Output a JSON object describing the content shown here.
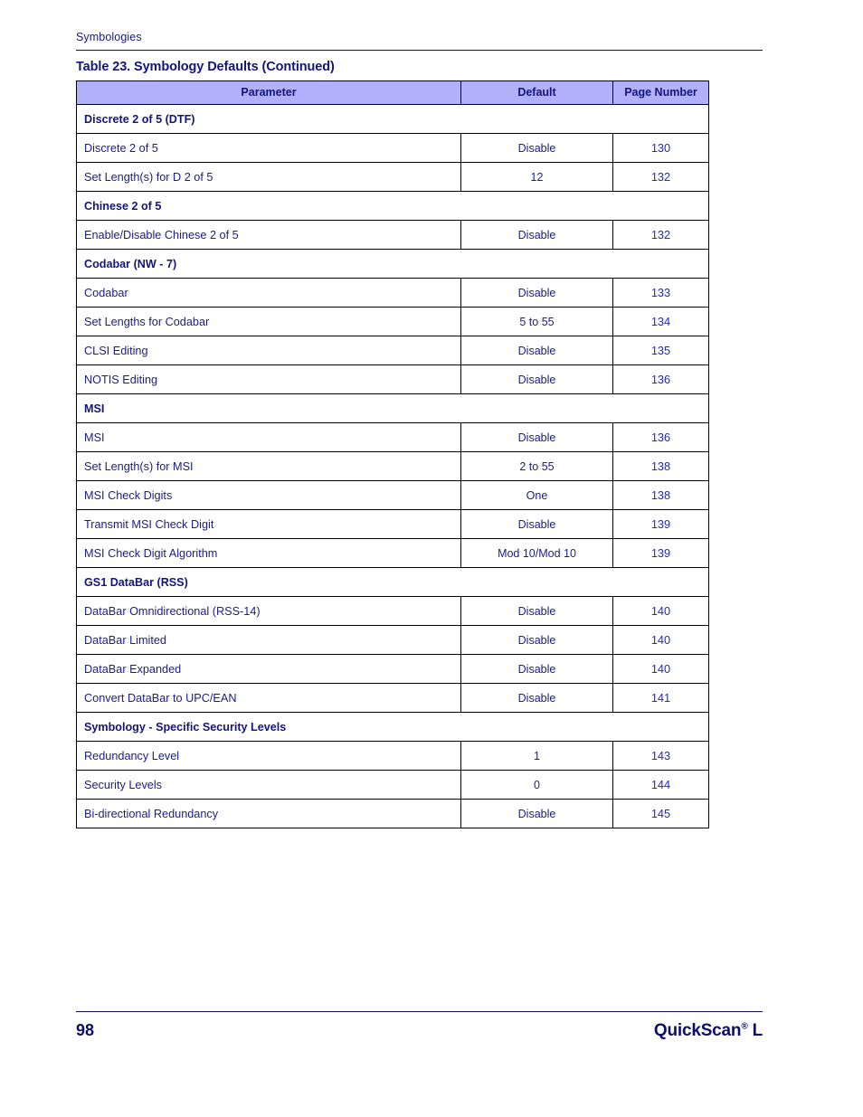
{
  "page": {
    "running_head": "Symbologies",
    "table_caption": "Table 23. Symbology Defaults (Continued)",
    "folio": "98",
    "book_title": "QuickScan",
    "book_title_sup": "®",
    "book_title_suffix": " L"
  },
  "colors": {
    "header_fill": "#b0b0fb",
    "heading_text": "#14147d",
    "body_text": "#1b1b8f",
    "page_link": "#2323e0",
    "rule": "#0d0d6b",
    "border": "#000000"
  },
  "table": {
    "columns": [
      "Parameter",
      "Default",
      "Page Number"
    ],
    "rows": [
      {
        "type": "section",
        "parameter": "Discrete 2 of 5 (DTF)"
      },
      {
        "type": "data",
        "parameter": "Discrete 2 of 5",
        "default": "Disable",
        "page": "130"
      },
      {
        "type": "data",
        "parameter": "Set Length(s) for D 2 of 5",
        "default": "12",
        "page": "132"
      },
      {
        "type": "section",
        "parameter": "Chinese 2 of 5"
      },
      {
        "type": "data",
        "parameter": "Enable/Disable Chinese 2 of 5",
        "default": "Disable",
        "page": "132"
      },
      {
        "type": "section",
        "parameter": "Codabar (NW - 7)"
      },
      {
        "type": "data",
        "parameter": "Codabar",
        "default": "Disable",
        "page": "133"
      },
      {
        "type": "data",
        "parameter": "Set Lengths for Codabar",
        "default": "5 to 55",
        "page": "134"
      },
      {
        "type": "data",
        "parameter": "CLSI Editing",
        "default": "Disable",
        "page": "135"
      },
      {
        "type": "data",
        "parameter": "NOTIS Editing",
        "default": "Disable",
        "page": "136"
      },
      {
        "type": "section",
        "parameter": "MSI"
      },
      {
        "type": "data",
        "parameter": "MSI",
        "default": "Disable",
        "page": "136"
      },
      {
        "type": "data",
        "parameter": "Set Length(s) for MSI",
        "default": "2 to 55",
        "page": "138"
      },
      {
        "type": "data",
        "parameter": "MSI Check Digits",
        "default": "One",
        "page": "138"
      },
      {
        "type": "data",
        "parameter": "Transmit MSI Check Digit",
        "default": "Disable",
        "page": "139"
      },
      {
        "type": "data",
        "parameter": "MSI Check Digit Algorithm",
        "default": "Mod 10/Mod 10",
        "page": "139"
      },
      {
        "type": "section",
        "parameter": "GS1 DataBar (RSS)"
      },
      {
        "type": "data",
        "parameter": "DataBar Omnidirectional (RSS-14)",
        "default": "Disable",
        "page": "140"
      },
      {
        "type": "data",
        "parameter": "DataBar Limited",
        "default": "Disable",
        "page": "140"
      },
      {
        "type": "data",
        "parameter": "DataBar Expanded",
        "default": "Disable",
        "page": "140"
      },
      {
        "type": "data",
        "parameter": "Convert DataBar to UPC/EAN",
        "default": "Disable",
        "page": "141"
      },
      {
        "type": "section",
        "parameter": "Symbology - Specific Security Levels"
      },
      {
        "type": "data",
        "parameter": "Redundancy Level",
        "default": "1",
        "page": "143"
      },
      {
        "type": "data",
        "parameter": "Security Levels",
        "default": "0",
        "page": "144"
      },
      {
        "type": "data",
        "parameter": "Bi-directional Redundancy",
        "default": "Disable",
        "page": "145"
      }
    ]
  }
}
